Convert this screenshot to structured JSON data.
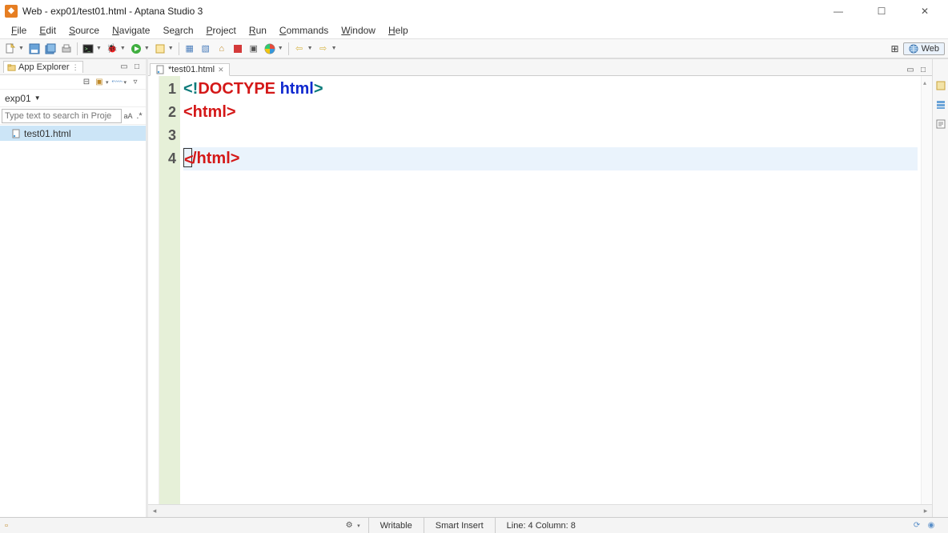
{
  "title": "Web - exp01/test01.html - Aptana Studio 3",
  "menu": [
    "File",
    "Edit",
    "Source",
    "Navigate",
    "Search",
    "Project",
    "Run",
    "Commands",
    "Window",
    "Help"
  ],
  "perspective_label": "Web",
  "explorer": {
    "view_title": "App Explorer",
    "project": "exp01",
    "search_placeholder": "Type text to search in Proje",
    "file": "test01.html"
  },
  "editor": {
    "tab_label": "*test01.html",
    "gutter": [
      "1",
      "2",
      "3",
      "4"
    ],
    "lines": {
      "l1_open": "<!",
      "l1_doctype": "DOCTYPE",
      "l1_sp": " ",
      "l1_html": "html",
      "l1_close": ">",
      "l2": "<html>",
      "l4_openbracket": "<",
      "l4_rest": "/html>"
    }
  },
  "status": {
    "writable": "Writable",
    "insert": "Smart Insert",
    "pos": "Line: 4 Column: 8"
  }
}
